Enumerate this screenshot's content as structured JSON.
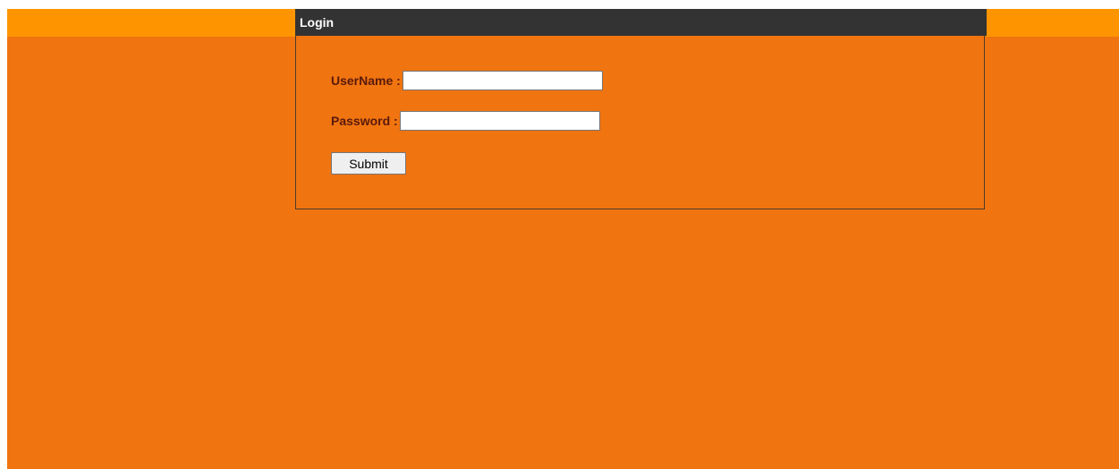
{
  "colors": {
    "page_background": "#f07410",
    "top_band": "#fe9500",
    "header_background": "#333333",
    "header_text": "#ffffff",
    "label_text": "#5a1a0c"
  },
  "login": {
    "title": "Login",
    "username_label": "UserName :",
    "username_value": "",
    "password_label": "Password :",
    "password_value": "",
    "submit_label": "Submit"
  }
}
